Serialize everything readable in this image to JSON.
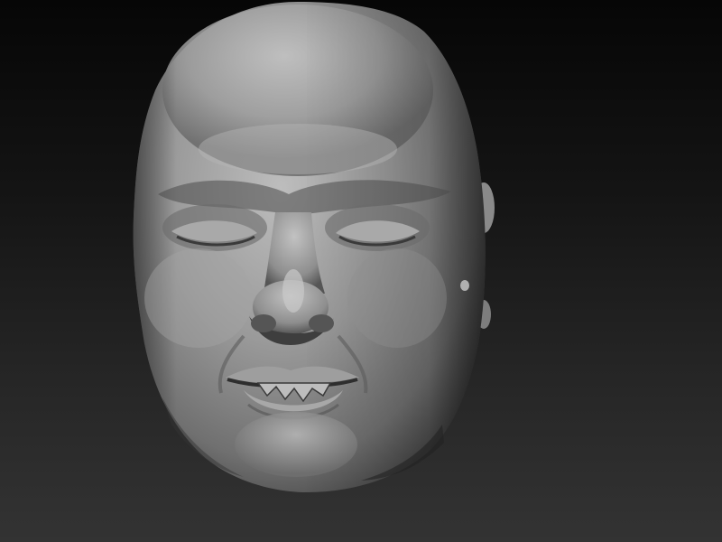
{
  "viewport": {
    "background_top": "#060606",
    "background_bottom": "#333333"
  },
  "model": {
    "material_color": "#8c8c8c",
    "highlight_color": "#c8c8c8",
    "shadow_color": "#2a2a2a",
    "icons": [
      "head-sculpt-mesh"
    ]
  }
}
